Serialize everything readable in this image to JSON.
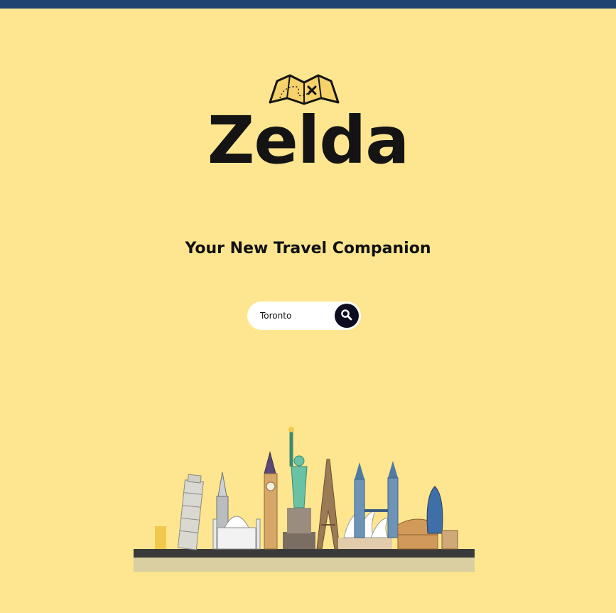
{
  "brand": {
    "name": "Zelda",
    "logo_icon": "treasure-map-icon"
  },
  "tagline": "Your New Travel Companion",
  "search": {
    "value": "Toronto",
    "button_icon": "search-icon"
  },
  "illustration": {
    "name": "world-landmarks-skyline"
  },
  "colors": {
    "background": "#fde68f",
    "top_bar": "#1e4472",
    "search_button": "#0d0d22"
  }
}
